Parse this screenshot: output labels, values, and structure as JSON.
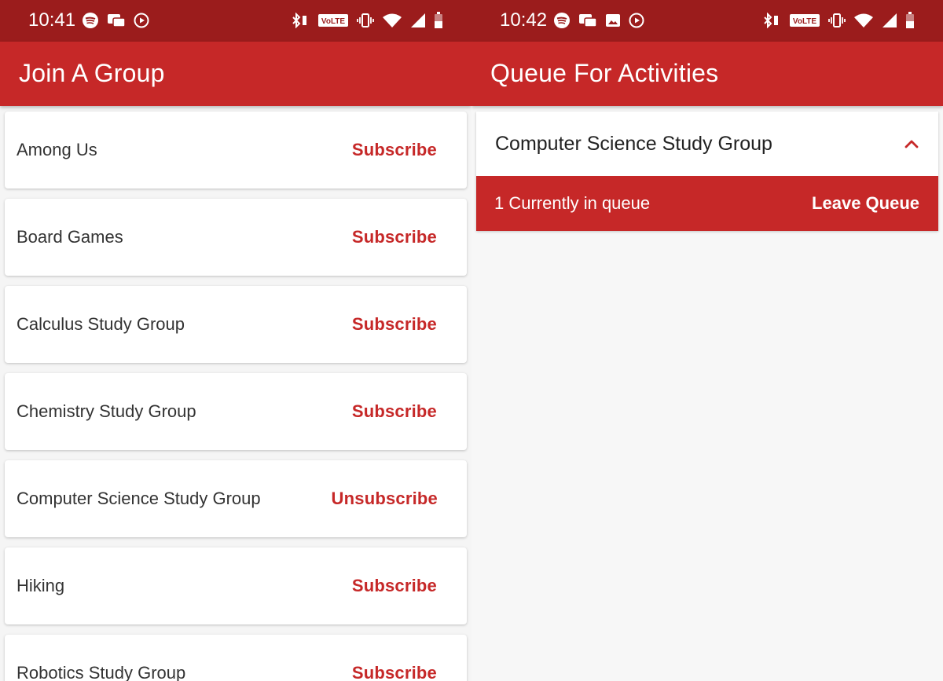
{
  "colors": {
    "primary": "#c62828",
    "statusbar": "#9b1c1c"
  },
  "left": {
    "status": {
      "time": "10:41",
      "volte": "VoLTE"
    },
    "title": "Join A Group",
    "groups": [
      {
        "name": "Among Us",
        "action": "Subscribe"
      },
      {
        "name": "Board Games",
        "action": "Subscribe"
      },
      {
        "name": "Calculus Study Group",
        "action": "Subscribe"
      },
      {
        "name": "Chemistry Study Group",
        "action": "Subscribe"
      },
      {
        "name": "Computer Science Study Group",
        "action": "Unsubscribe"
      },
      {
        "name": "Hiking",
        "action": "Subscribe"
      },
      {
        "name": "Robotics Study Group",
        "action": "Subscribe"
      }
    ]
  },
  "right": {
    "status": {
      "time": "10:42",
      "volte": "VoLTE"
    },
    "title": "Queue For Activities",
    "queue": {
      "group": "Computer Science Study Group",
      "status": "1 Currently in queue",
      "action": "Leave Queue"
    }
  }
}
